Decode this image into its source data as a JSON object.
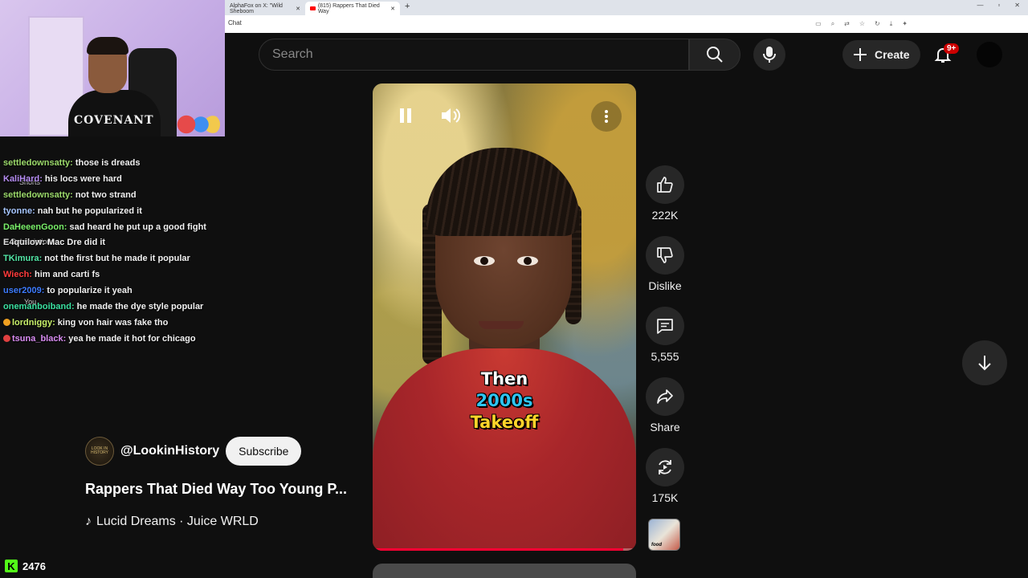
{
  "browser": {
    "tabs": [
      {
        "label": "AlphaFox on X: \"Wild Sheboom"
      },
      {
        "label": "(815) Rappers That Died Way"
      }
    ],
    "new_tab": "+",
    "chat_label": "Chat"
  },
  "header": {
    "search_placeholder": "Search",
    "create_label": "Create",
    "notification_count": "9+"
  },
  "webcam": {
    "shirt_text": "COVENANT"
  },
  "chat": [
    {
      "user": "settledownsatty",
      "color": "#9bd96a",
      "msg": "those is dreads",
      "badge": ""
    },
    {
      "user": "KaliHard",
      "color": "#b58cf2",
      "msg": "his locs were hard",
      "badge": ""
    },
    {
      "user": "settledownsatty",
      "color": "#9bd96a",
      "msg": "not two strand",
      "badge": ""
    },
    {
      "user": "tyonne",
      "color": "#a7c7ff",
      "msg": "nah but he popularized it",
      "badge": ""
    },
    {
      "user": "DaHeeenGoon",
      "color": "#7af06a",
      "msg": "sad heard he put up a good fight",
      "badge": ""
    },
    {
      "user": "E4quilow",
      "color": "#e0e0e0",
      "msg": "Mac Dre did it",
      "badge": ""
    },
    {
      "user": "TKimura",
      "color": "#53e6a6",
      "msg": "not the first but he made it popular",
      "badge": ""
    },
    {
      "user": "Wiech",
      "color": "#ff3b3b",
      "msg": "him and carti fs",
      "badge": ""
    },
    {
      "user": "user2009",
      "color": "#3d7cff",
      "msg": "to popularize it yeah",
      "badge": ""
    },
    {
      "user": "onemanboiband",
      "color": "#3ae0a0",
      "msg": "he made the dye style popular",
      "badge": ""
    },
    {
      "user": "lordniggy",
      "color": "#c9f06a",
      "msg": "king von hair was fake tho",
      "badge": "#f0a020"
    },
    {
      "user": "tsuna_black",
      "color": "#d98cf2",
      "msg": "yea he made it hot for chicago",
      "badge": "#e04040"
    }
  ],
  "sidebar_ghost": {
    "shorts": "Shorts",
    "subscriptions": "Subscriptions",
    "you": "You"
  },
  "kick": {
    "logo": "K",
    "count": "2476"
  },
  "video": {
    "captions": [
      "Then",
      "2000s",
      "Takeoff"
    ],
    "progress": 0.95
  },
  "channel": {
    "avatar_text": "LOOK IN HISTORY",
    "name": "@LookinHistory",
    "subscribe_label": "Subscribe"
  },
  "title": "Rappers That Died Way Too Young P...",
  "music": "Lucid Dreams · Juice WRLD",
  "actions": {
    "like_count": "222K",
    "dislike_label": "Dislike",
    "comment_count": "5,555",
    "share_label": "Share",
    "remix_count": "175K",
    "thumb_text": "food"
  }
}
